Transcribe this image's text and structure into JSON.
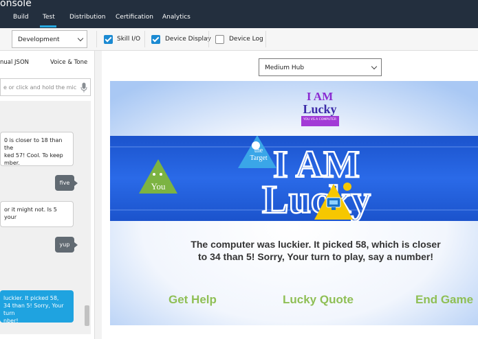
{
  "app": {
    "title": "onsole"
  },
  "nav": {
    "tabs": [
      "Build",
      "Test",
      "Distribution",
      "Certification",
      "Analytics"
    ],
    "active": "Test"
  },
  "toolbar": {
    "environment": "Development",
    "options": [
      {
        "label": "Skill I/O",
        "checked": true
      },
      {
        "label": "Device Display",
        "checked": true
      },
      {
        "label": "Device Log",
        "checked": false
      }
    ]
  },
  "left_panel": {
    "tabs": [
      "nual JSON",
      "Voice & Tone"
    ],
    "utterance_placeholder": "e or click and hold the mic",
    "chat": [
      {
        "from": "alexa",
        "lines": [
          "0 is closer to 18 than the",
          "ked 57! Cool. To keep",
          "mber."
        ]
      },
      {
        "from": "user",
        "text": "five"
      },
      {
        "from": "alexa",
        "lines": [
          " or it might not. Is 5 your"
        ]
      },
      {
        "from": "user",
        "text": "yup"
      },
      {
        "from": "alexa",
        "lines": [
          " luckier. It picked 58,",
          "34 than 5! Sorry, Your turn",
          "nber!"
        ]
      }
    ]
  },
  "device": {
    "selected": "Medium Hub",
    "logo": {
      "line1": "I AM",
      "line2": "Lucky",
      "subtitle": "YOU VS A COMPUTER"
    },
    "banner_text": {
      "line1": "I AM",
      "line2": "Lucky"
    },
    "markers": {
      "you": "You",
      "target": "the Target"
    },
    "message": "The computer was luckier. It picked 58, which is closer to 34 than 5! Sorry, Your turn to play, say a number!",
    "buttons": [
      "Get Help",
      "Lucky Quote",
      "End Game"
    ]
  },
  "colors": {
    "nav_bg": "#232f3e",
    "accent": "#1b8ad2",
    "banner": "#1b53cc",
    "button_text": "#8fbf55",
    "bubble_blue": "#1fa3e0"
  }
}
